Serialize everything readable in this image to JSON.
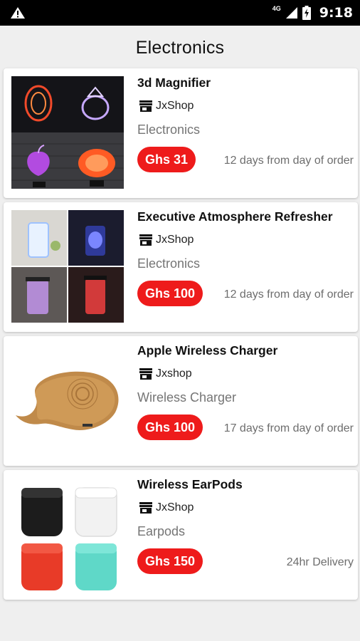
{
  "status_bar": {
    "time": "9:18",
    "network": "4G"
  },
  "page_title": "Electronics",
  "products": [
    {
      "title": "3d Magnifier",
      "shop": "JxShop",
      "category": "Electronics",
      "price": "Ghs 31",
      "delivery": "12 days from day of order"
    },
    {
      "title": "Executive Atmosphere Refresher",
      "shop": "JxShop",
      "category": "Electronics",
      "price": "Ghs 100",
      "delivery": "12 days from day of order"
    },
    {
      "title": "Apple Wireless Charger",
      "shop": "Jxshop",
      "category": "Wireless Charger",
      "price": "Ghs 100",
      "delivery": "17 days from day of order"
    },
    {
      "title": "Wireless EarPods",
      "shop": "JxShop",
      "category": "Earpods",
      "price": "Ghs 150",
      "delivery": "24hr Delivery"
    }
  ],
  "colors": {
    "price_badge": "#ee1b1b",
    "background": "#efefef",
    "status_bar": "#000000"
  },
  "icons": {
    "warning": "warning-icon",
    "store": "store-icon",
    "signal": "signal-icon",
    "battery": "battery-icon"
  }
}
